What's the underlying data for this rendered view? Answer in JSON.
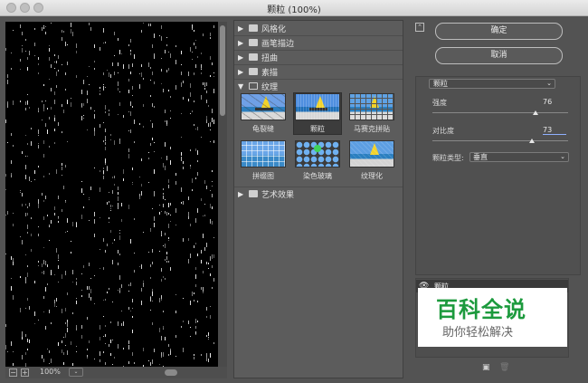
{
  "window": {
    "title": "颗粒 (100%)"
  },
  "preview": {
    "zoom": "100%",
    "zoom_out": "−",
    "zoom_in": "+",
    "zoom_caret": "⌄"
  },
  "gallery": {
    "folders_top": [
      {
        "label": "风格化",
        "open": false
      },
      {
        "label": "画笔描边",
        "open": false
      },
      {
        "label": "扭曲",
        "open": false
      },
      {
        "label": "素描",
        "open": false
      },
      {
        "label": "纹理",
        "open": true
      }
    ],
    "folders_bottom": [
      {
        "label": "艺术效果",
        "open": false
      }
    ],
    "arrow_closed": "▶",
    "arrow_open": "▼",
    "texture_items": [
      {
        "label": "龟裂缝",
        "selected": false
      },
      {
        "label": "颗粒",
        "selected": true
      },
      {
        "label": "马赛克拼贴",
        "selected": false
      },
      {
        "label": "拼缀图",
        "selected": false
      },
      {
        "label": "染色玻璃",
        "selected": false
      },
      {
        "label": "纹理化",
        "selected": false
      }
    ]
  },
  "buttons": {
    "ok": "确定",
    "cancel": "取消",
    "collapse": "⌃"
  },
  "settings": {
    "filter": "颗粒",
    "caret": "⌄",
    "params": [
      {
        "label": "强度",
        "value": "76",
        "fraction": 0.76
      },
      {
        "label": "对比度",
        "value": "73",
        "fraction": 0.73
      }
    ],
    "grain_type_label": "颗粒类型:",
    "grain_type": "垂直"
  },
  "layers": {
    "name": "颗粒",
    "eye": "👁",
    "new_icon": "▣",
    "delete_icon": "🗑"
  },
  "watermark": {
    "title": "百科全说",
    "subtitle": "助你轻松解决"
  },
  "colors": {
    "bg": "#535353",
    "preview": "#000000",
    "accent": "#8fb0ff",
    "watermark_green": "#1c9a3d"
  }
}
